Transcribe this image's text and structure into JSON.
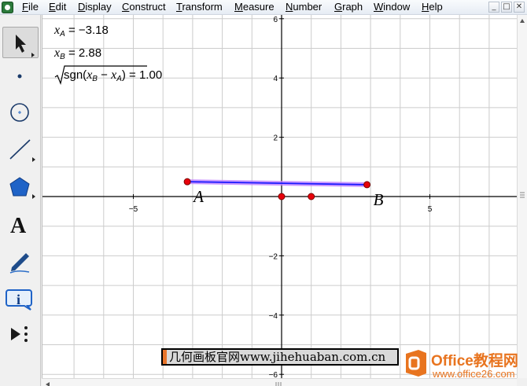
{
  "menu": {
    "items": [
      "File",
      "Edit",
      "Display",
      "Construct",
      "Transform",
      "Measure",
      "Number",
      "Graph",
      "Window",
      "Help"
    ],
    "accelerators": [
      "F",
      "E",
      "D",
      "C",
      "T",
      "M",
      "N",
      "G",
      "W",
      "H"
    ]
  },
  "window_controls": {
    "minimize": "_",
    "restore": "□",
    "close": "✕"
  },
  "toolbox": [
    "selection-arrow-tool",
    "point-tool",
    "compass-tool",
    "straightedge-tool",
    "polygon-tool",
    "text-tool",
    "marker-tool",
    "information-tool",
    "custom-tool"
  ],
  "measurements": {
    "xa": {
      "var": "x",
      "sub": "A",
      "eq": " = ",
      "value": "−3.18"
    },
    "xb": {
      "var": "x",
      "sub": "B",
      "eq": " = ",
      "value": "2.88"
    },
    "expr": {
      "fn": "sgn(",
      "v1": "x",
      "s1": "B",
      "minus": " − ",
      "v2": "x",
      "s2": "A",
      "close": ")",
      "eq": " = ",
      "value": "1.00"
    }
  },
  "chart_data": {
    "type": "scatter",
    "grid": true,
    "xlim": [
      -7.4,
      8.5
    ],
    "ylim": [
      -6.1,
      6.1
    ],
    "x_ticks": [
      -5,
      5
    ],
    "y_ticks": [
      6,
      4,
      2,
      -2,
      -4,
      -6
    ],
    "tick_labels": {
      "x": [
        "−5",
        "5"
      ],
      "y": [
        "6",
        "4",
        "2",
        "−2",
        "−4",
        "−6"
      ]
    },
    "segment": {
      "from": [
        -3.18,
        0.5
      ],
      "to": [
        2.88,
        0.4
      ],
      "color": "#1a1aff",
      "highlight": "#c080ff"
    },
    "points": [
      {
        "label": "A",
        "x": -3.18,
        "y": 0.5
      },
      {
        "label": "B",
        "x": 2.88,
        "y": 0.4
      },
      {
        "label": "",
        "x": 0,
        "y": 0
      },
      {
        "label": "",
        "x": 1,
        "y": 0
      }
    ],
    "point_color": "#e8000b"
  },
  "watermark": {
    "jihe": "几何画板官网www.jihehuaban.com.cn",
    "office_word": "Office教程网",
    "office_url": "www.office26.com"
  },
  "colors": {
    "grid": "#cccccc",
    "axis": "#000000",
    "point": "#e8000b",
    "segment": "#1a1aff"
  }
}
